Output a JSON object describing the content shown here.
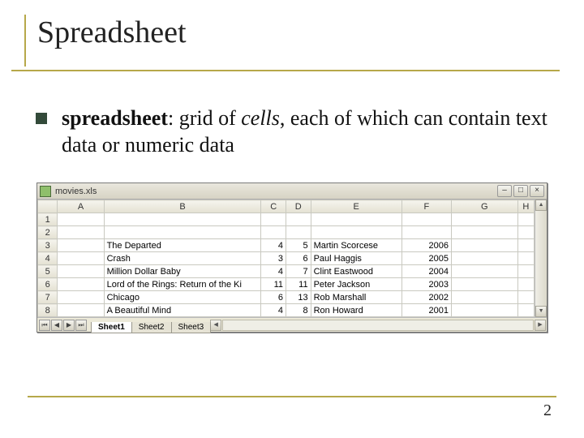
{
  "slide": {
    "title": "Spreadsheet",
    "bullet_term": "spreadsheet",
    "bullet_rest_1": ": grid of ",
    "bullet_italic": "cells",
    "bullet_rest_2": ", each of which can contain text data or numeric data",
    "page_number": "2"
  },
  "window": {
    "filename": "movies.xls",
    "min_label": "–",
    "max_label": "□",
    "close_label": "×"
  },
  "columns": [
    "A",
    "B",
    "C",
    "D",
    "E",
    "F",
    "G",
    "H"
  ],
  "rows": [
    {
      "n": "1",
      "A": "",
      "B": "",
      "C": "",
      "D": "",
      "E": "",
      "F": "",
      "G": ""
    },
    {
      "n": "2",
      "A": "",
      "B": "",
      "C": "",
      "D": "",
      "E": "",
      "F": "",
      "G": ""
    },
    {
      "n": "3",
      "A": "",
      "B": "The Departed",
      "C": "4",
      "D": "5",
      "E": "Martin Scorcese",
      "F": "2006",
      "G": ""
    },
    {
      "n": "4",
      "A": "",
      "B": "Crash",
      "C": "3",
      "D": "6",
      "E": "Paul Haggis",
      "F": "2005",
      "G": ""
    },
    {
      "n": "5",
      "A": "",
      "B": "Million Dollar Baby",
      "C": "4",
      "D": "7",
      "E": "Clint Eastwood",
      "F": "2004",
      "G": ""
    },
    {
      "n": "6",
      "A": "",
      "B": "Lord of the Rings: Return of the Ki",
      "C": "11",
      "D": "11",
      "E": "Peter Jackson",
      "F": "2003",
      "G": ""
    },
    {
      "n": "7",
      "A": "",
      "B": "Chicago",
      "C": "6",
      "D": "13",
      "E": "Rob Marshall",
      "F": "2002",
      "G": ""
    },
    {
      "n": "8",
      "A": "",
      "B": "A Beautiful Mind",
      "C": "4",
      "D": "8",
      "E": "Ron Howard",
      "F": "2001",
      "G": ""
    }
  ],
  "tabs": {
    "nav_first": "⏮",
    "nav_prev": "◀",
    "nav_next": "▶",
    "nav_last": "⏭",
    "items": [
      "Sheet1",
      "Sheet2",
      "Sheet3"
    ],
    "active": "Sheet1",
    "scroll_left": "◀",
    "scroll_right": "▶"
  },
  "scroll": {
    "up": "▲",
    "down": "▼"
  }
}
